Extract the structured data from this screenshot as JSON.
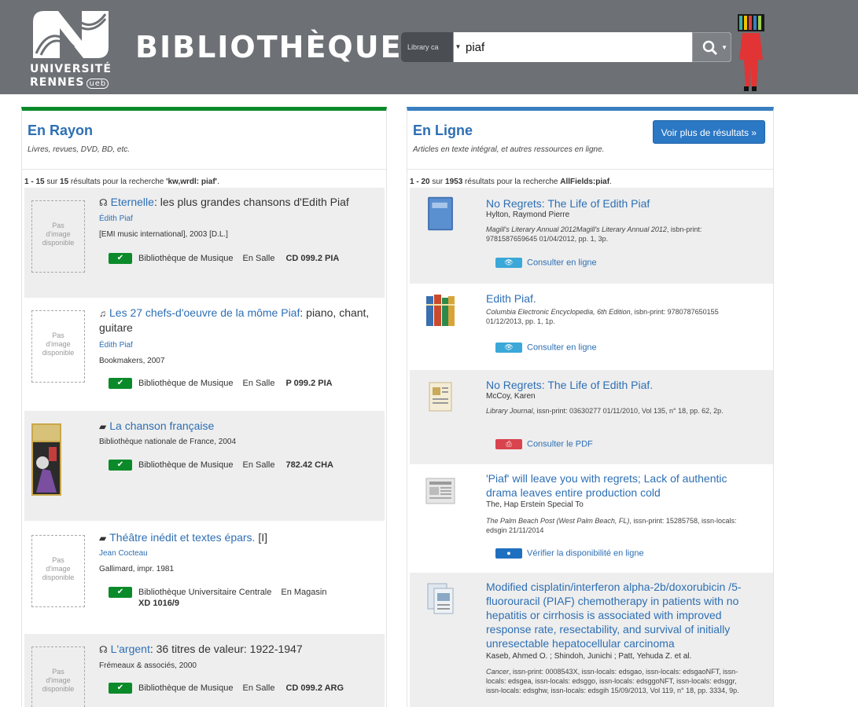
{
  "header": {
    "logo_line1": "UNIVERSITÉ",
    "logo_line2": "RENNES",
    "logo_ueb": "ueb",
    "title": "BIBLIOTHÈQUES",
    "search_type": "Library ca",
    "search_value": "piaf"
  },
  "left": {
    "title": "En Rayon",
    "subtitle": "Livres, revues, DVD, BD, etc.",
    "count_range": "1 - 15",
    "count_mid": " sur ",
    "count_total": "15",
    "count_text": " résultats pour la recherche ",
    "count_query": "'kw,wrdl: piaf'",
    "no_image_1": "Pas",
    "no_image_2": "d'image",
    "no_image_3": "disponible",
    "records": [
      {
        "format_icon": "audio-icon",
        "title_link": "Eternelle",
        "title_rest": ": les plus grandes chansons d'Edith Piaf",
        "author": "Édith Piaf",
        "publisher": "[EMI music international], 2003 [D.L.]",
        "library": "Bibliothèque de Musique",
        "location": "En Salle",
        "callno": "CD 099.2 PIA"
      },
      {
        "format_icon": "music-score-icon",
        "title_link": "Les 27 chefs-d'oeuvre de la môme Piaf",
        "title_rest": ": piano, chant, guitare",
        "author": "Édith Piaf",
        "publisher": "Bookmakers, 2007",
        "library": "Bibliothèque de Musique",
        "location": "En Salle",
        "callno": "P 099.2 PIA"
      },
      {
        "format_icon": "book-icon",
        "title_link": "La chanson française",
        "title_rest": "",
        "author": "",
        "publisher": "Bibliothèque nationale de France, 2004",
        "library": "Bibliothèque de Musique",
        "location": "En Salle",
        "callno": "782.42 CHA"
      },
      {
        "format_icon": "book-icon",
        "title_link": "Théâtre inédit et textes épars.",
        "title_rest": " [I]",
        "author": "Jean Cocteau",
        "publisher": "Gallimard, impr. 1981",
        "library": "Bibliothèque Universitaire Centrale",
        "location": "En Magasin",
        "callno": "XD 1016/9"
      },
      {
        "format_icon": "audio-icon",
        "title_link": "L'argent",
        "title_rest": ": 36 titres de valeur: 1922-1947",
        "author": "",
        "publisher": "Frémeaux & associés, 2000",
        "library": "Bibliothèque de Musique",
        "location": "En Salle",
        "callno": "CD 099.2 ARG"
      }
    ]
  },
  "right": {
    "title": "En Ligne",
    "subtitle": "Articles en texte intégral, et autres ressources en ligne.",
    "more_button": "Voir plus de résultats »",
    "count_range": "1 - 20",
    "count_mid": " sur ",
    "count_total": "1953",
    "count_text": " résultats pour la recherche ",
    "count_query": "AllFields:piaf",
    "count_end": ".",
    "records": [
      {
        "icon": "book-cover-icon",
        "title": "No Regrets: The Life of Edith Piaf",
        "author": "Hylton, Raymond Pierre",
        "source_italic": "Magill's Literary Annual 2012Magill's Literary Annual 2012",
        "source_rest": ", isbn-print: 9781587659645 01/04/2012, pp. 1, 3p.",
        "link": "Consulter en ligne",
        "badge": "eye"
      },
      {
        "icon": "encyclopedia-icon",
        "title": "Edith Piaf.",
        "author": "",
        "source_italic": "Columbia Electronic Encyclopedia, 6th Edition",
        "source_rest": ", isbn-print: 9780787650155 01/12/2013, pp. 1, 1p.",
        "link": "Consulter en ligne",
        "badge": "eye"
      },
      {
        "icon": "periodical-icon",
        "title": "No Regrets: The Life of Edith Piaf.",
        "author": "McCoy, Karen",
        "source_italic": "Library Journal",
        "source_rest": ", issn-print: 03630277 01/11/2010, Vol 135, n° 18, pp. 62, 2p.",
        "link": "Consulter le PDF",
        "badge": "pdf"
      },
      {
        "icon": "newspaper-icon",
        "title": "'Piaf' will leave you with regrets; Lack of authentic drama leaves entire production cold",
        "author": "The, Hap Erstein Special To",
        "source_italic": "The Palm Beach Post (West Palm Beach, FL)",
        "source_rest": ", issn-print: 15285758, issn-locals: edsgin 21/11/2014",
        "link": "Vérifier la disponibilité en ligne",
        "badge": "globe"
      },
      {
        "icon": "academic-journal-icon",
        "title": "Modified cisplatin/interferon alpha-2b/doxorubicin /5-fluorouracil (PIAF) chemotherapy in patients with no hepatitis or cirrhosis is associated with improved response rate, resectability, and survival of initially unresectable hepatocellular carcinoma",
        "author": "Kaseb, Ahmed O. ; Shindoh, Junichi ; Patt, Yehuda Z. et al.",
        "source_italic": "Cancer",
        "source_rest": ", issn-print: 0008543X, issn-locals: edsgao, issn-locals: edsgaoNFT, issn-locals: edsgea, issn-locals: edsggo, issn-locals: edsggoNFT, issn-locals: edsggr, issn-locals: edsghw, issn-locals: edsgih 15/09/2013, Vol 119, n° 18, pp. 3334, 9p.",
        "link": "",
        "badge": ""
      }
    ]
  },
  "colors": {
    "header_bg": "#6d7074",
    "left_accent": "#0b8a2a",
    "right_accent": "#3a7ec0",
    "link": "#2d6fb4"
  }
}
